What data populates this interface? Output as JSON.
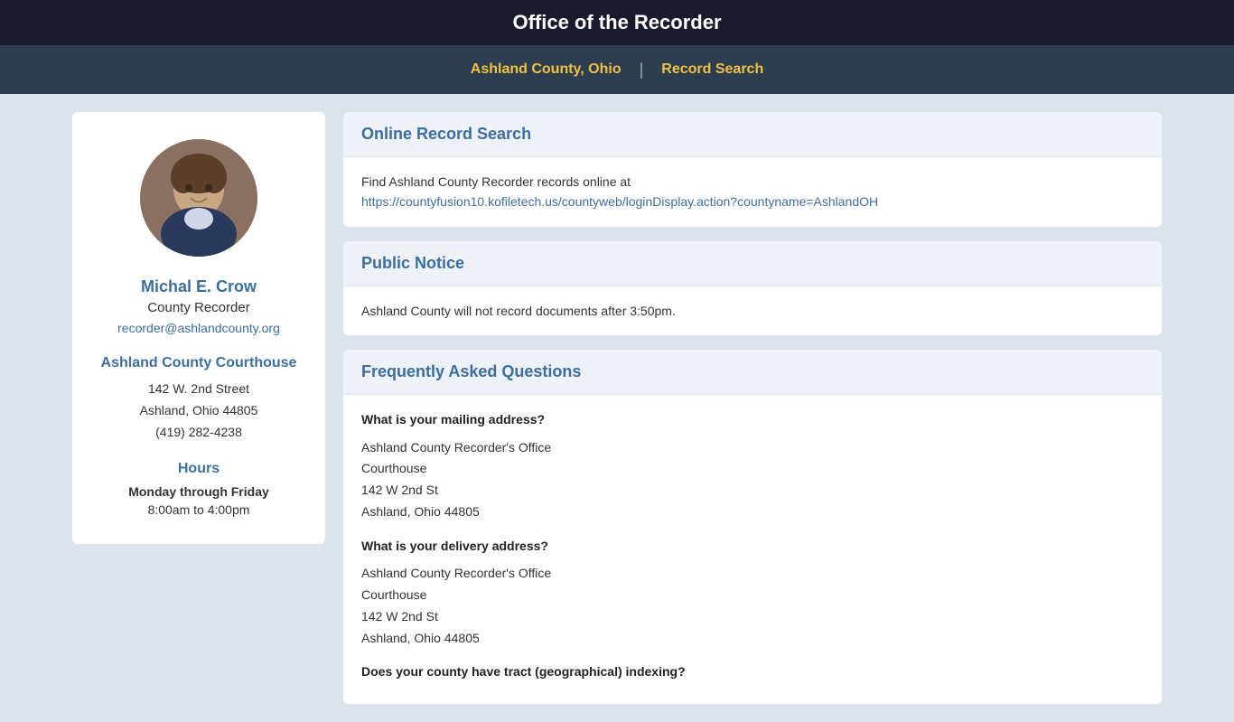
{
  "header": {
    "title": "Office of the Recorder"
  },
  "nav": {
    "county_link": "Ashland County, Ohio",
    "separator": "|",
    "search_link": "Record Search"
  },
  "sidebar": {
    "person_name": "Michal E. Crow",
    "person_title": "County Recorder",
    "person_email": "recorder@ashlandcounty.org",
    "courthouse_label": "Ashland County Courthouse",
    "address_line1": "142 W. 2nd Street",
    "address_line2": "Ashland, Ohio 44805",
    "address_phone": "(419) 282-4238",
    "hours_label": "Hours",
    "hours_days": "Monday through Friday",
    "hours_time": "8:00am to 4:00pm"
  },
  "online_record_search": {
    "title": "Online Record Search",
    "intro_text": "Find Ashland County Recorder records online at",
    "link_text": "https://countyfusion10.kofiletech.us/countyweb/loginDisplay.action?countyname=AshlandOH",
    "link_href": "https://countyfusion10.kofiletech.us/countyweb/loginDisplay.action?countyname=AshlandOH"
  },
  "public_notice": {
    "title": "Public Notice",
    "body": "Ashland County will not record documents after 3:50pm."
  },
  "faq": {
    "title": "Frequently Asked Questions",
    "items": [
      {
        "question": "What is your mailing address?",
        "answer_lines": [
          "Ashland County Recorder's Office",
          "Courthouse",
          "142 W 2nd St",
          "Ashland, Ohio 44805"
        ]
      },
      {
        "question": "What is your delivery address?",
        "answer_lines": [
          "Ashland County Recorder's Office",
          "Courthouse",
          "142 W 2nd St",
          "Ashland, Ohio 44805"
        ]
      },
      {
        "question": "Does your county have tract (geographical) indexing?"
      }
    ]
  }
}
